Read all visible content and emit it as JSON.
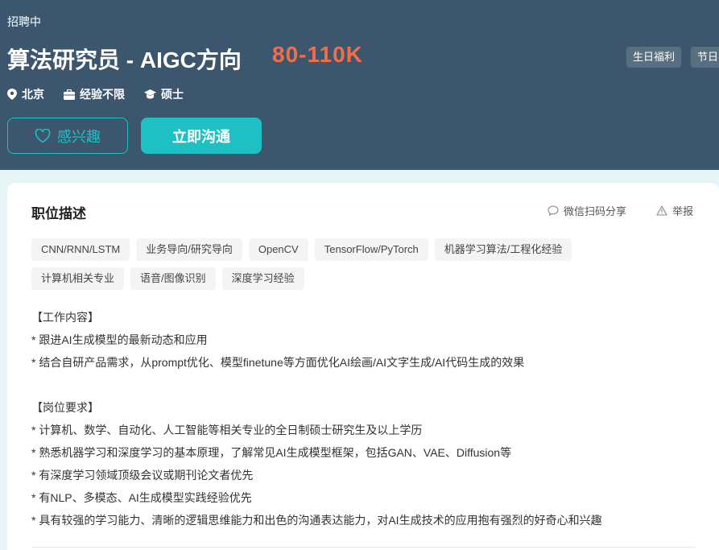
{
  "header": {
    "status": "招聘中",
    "title": "算法研究员 - AIGC方向",
    "salary": "80-110K",
    "welfare": [
      "生日福利",
      "节日"
    ],
    "meta": {
      "location": "北京",
      "experience": "经验不限",
      "degree": "硕士"
    },
    "buttons": {
      "interest": "感兴趣",
      "chat": "立即沟通"
    },
    "colors": {
      "background": "#3b566d",
      "accent": "#1fc0c4",
      "salary": "#f26d4a"
    }
  },
  "card": {
    "title": "职位描述",
    "share": "微信扫码分享",
    "report": "举报",
    "tags": [
      "CNN/RNN/LSTM",
      "业务导向/研究导向",
      "OpenCV",
      "TensorFlow/PyTorch",
      "机器学习算法/工程化经验",
      "计算机相关专业",
      "语音/图像识别",
      "深度学习经验"
    ],
    "description": [
      "【工作内容】",
      "* 跟进AI生成模型的最新动态和应用",
      "* 结合自研产品需求，从prompt优化、模型finetune等方面优化AI绘画/AI文字生成/AI代码生成的效果",
      "",
      "【岗位要求】",
      "* 计算机、数学、自动化、人工智能等相关专业的全日制硕士研究生及以上学历",
      "* 熟悉机器学习和深度学习的基本原理，了解常见AI生成模型框架，包括GAN、VAE、Diffusion等",
      "* 有深度学习领域顶级会议或期刊论文者优先",
      "* 有NLP、多模态、AI生成模型实践经验优先",
      "* 具有较强的学习能力、清晰的逻辑思维能力和出色的沟通表达能力，对AI生成技术的应用抱有强烈的好奇心和兴趣"
    ]
  }
}
